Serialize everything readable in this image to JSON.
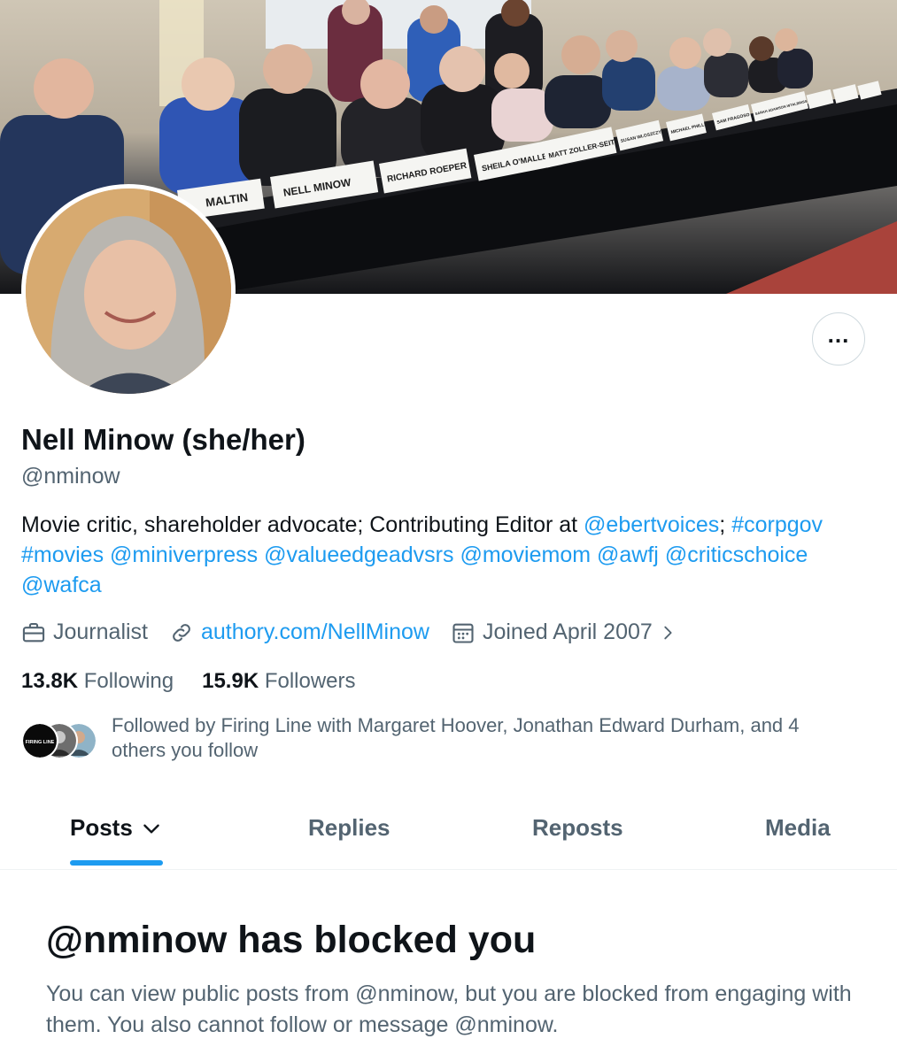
{
  "banner": {
    "placards": [
      "MALTIN",
      "NELL MINOW",
      "RICHARD ROEPER",
      "SHEILA O'MALLEY",
      "MATT ZOLLER-SEITZ",
      "SUSAN WLOSZCZYNA",
      "MICHAEL PHILLIPS",
      "SAM FRAGOSO",
      "SARAH ADAMSON WTALBRISS"
    ]
  },
  "profile": {
    "name": "Nell Minow (she/her)",
    "handle": "@nminow",
    "bio": [
      {
        "text": "Movie critic, shareholder advocate; Contributing Editor at ",
        "link": false
      },
      {
        "text": "@ebertvoices",
        "link": true
      },
      {
        "text": "; ",
        "link": false
      },
      {
        "text": "#corpgov",
        "link": true
      },
      {
        "text": " ",
        "link": false
      },
      {
        "text": "#movies",
        "link": true
      },
      {
        "text": " ",
        "link": false
      },
      {
        "text": "@miniverpress",
        "link": true
      },
      {
        "text": " ",
        "link": false
      },
      {
        "text": "@valueedgeadvsrs",
        "link": true
      },
      {
        "text": " ",
        "link": false
      },
      {
        "text": "@moviemom",
        "link": true
      },
      {
        "text": " ",
        "link": false
      },
      {
        "text": "@awfj",
        "link": true
      },
      {
        "text": " ",
        "link": false
      },
      {
        "text": "@criticschoice",
        "link": true
      },
      {
        "text": " ",
        "link": false
      },
      {
        "text": "@wafca",
        "link": true
      }
    ],
    "profession": "Journalist",
    "website": "authory.com/NellMinow",
    "joined": "Joined April 2007",
    "following_count": "13.8K",
    "following_label": "Following",
    "followers_count": "15.9K",
    "followers_label": "Followers",
    "followed_by": "Followed by Firing Line with Margaret Hoover, Jonathan Edward Durham, and 4 others you follow",
    "facepile_first_label": "FIRING LINE"
  },
  "tabs": [
    {
      "label": "Posts",
      "active": true
    },
    {
      "label": "Replies",
      "active": false
    },
    {
      "label": "Reposts",
      "active": false
    },
    {
      "label": "Media",
      "active": false
    }
  ],
  "blocked": {
    "title": "@nminow has blocked you",
    "message": "You can view public posts from @nminow, but you are blocked from engaging with them. You also cannot follow or message @nminow."
  },
  "colors": {
    "accent": "#1d9bf0",
    "text_primary": "#0f1419",
    "text_secondary": "#536471"
  },
  "icons": {
    "more": "more-horizontal-icon",
    "profession": "briefcase-icon",
    "website": "link-icon",
    "joined": "calendar-icon",
    "posts_dropdown": "chevron-down-icon",
    "joined_more": "chevron-right-icon"
  }
}
